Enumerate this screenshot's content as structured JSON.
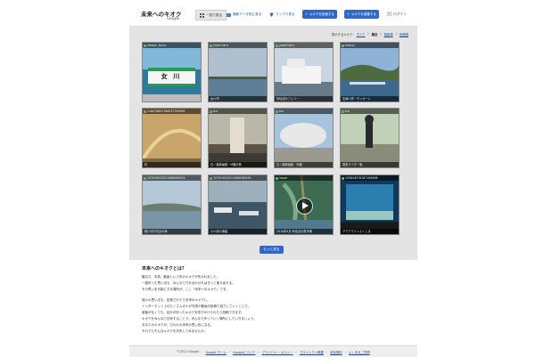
{
  "header": {
    "logo": "未来へのキオク",
    "logo_sub": "Google",
    "nav": [
      {
        "label": "一覧で見る",
        "icon": "grid-icon"
      },
      {
        "label": "撮影データ別に見る",
        "icon": "photo-icon"
      },
      {
        "label": "マップで見る",
        "icon": "map-pin-icon"
      }
    ],
    "buttons": [
      {
        "label": "キオクを投稿する",
        "icon": "plus-icon"
      },
      {
        "label": "キオクを募集する",
        "icon": "plus-icon"
      }
    ],
    "login": "ログイン"
  },
  "sortbar": {
    "prefix": "表示するキオク:",
    "options": [
      "すべて",
      "最近",
      "撮影順",
      "投稿順"
    ]
  },
  "thumbnails": [
    {
      "user": "okosen_touru",
      "caption": ""
    },
    {
      "user": "yoshi hara",
      "caption": "女川湾"
    },
    {
      "user": "yoshi hara",
      "caption": "気仙沼のフェリー"
    },
    {
      "user": "katsuo",
      "caption": "志津川湾・サンオーレ"
    },
    {
      "user": "118078802786037399585",
      "caption": "虹"
    },
    {
      "user": "tce",
      "caption": "石ノ森萬画館・M展示物"
    },
    {
      "user": "tce",
      "caption": "石ノ森萬画館・外観"
    },
    {
      "user": "tce",
      "caption": "図書ライダー像"
    },
    {
      "user": "107615029221669089439",
      "caption": "鮫川河口付近の海"
    },
    {
      "user": "107615029221669089439",
      "caption": "小川原の漁船"
    },
    {
      "user": "inoue",
      "caption": "2010年4月 気仙沼の魚市場"
    },
    {
      "user": "105844578187185698",
      "caption": "アクアマリンふくしま"
    }
  ],
  "more_button": "もっと見る",
  "about": {
    "title": "未来へのキオクとは？",
    "paragraph1": [
      "震災で、写真、動画という形のキオクが失われました。",
      "一度失った思い出も、みんなで力を合わせればきっと取り戻せる。",
      "その思いを可能にする場所が、ここ「未来へのキオク」です。"
    ],
    "paragraph2": [
      "個人の思い出も、記録されたら未来のキオクに。",
      "インターネット上のたくさんの人が写真や動画の投稿で協力していくことで、",
      "被害がなくても、自分が持ったキオクを呼びかけられたら投稿できます。",
      "キオクをみんなで共有することで、みんなで作っていく場所にしていきましょう。",
      "あなたのキオクが、だれかの未来の思い出になる、",
      "それでもそんなキオクを共有してみませんか。"
    ]
  },
  "footer": {
    "copyright": "©2011 Google",
    "links": [
      "Google ホーム",
      "Googleについて",
      "プライバシー ポリシー",
      "プロジェクト概要",
      "参加規約",
      "よくあるご質問"
    ]
  }
}
